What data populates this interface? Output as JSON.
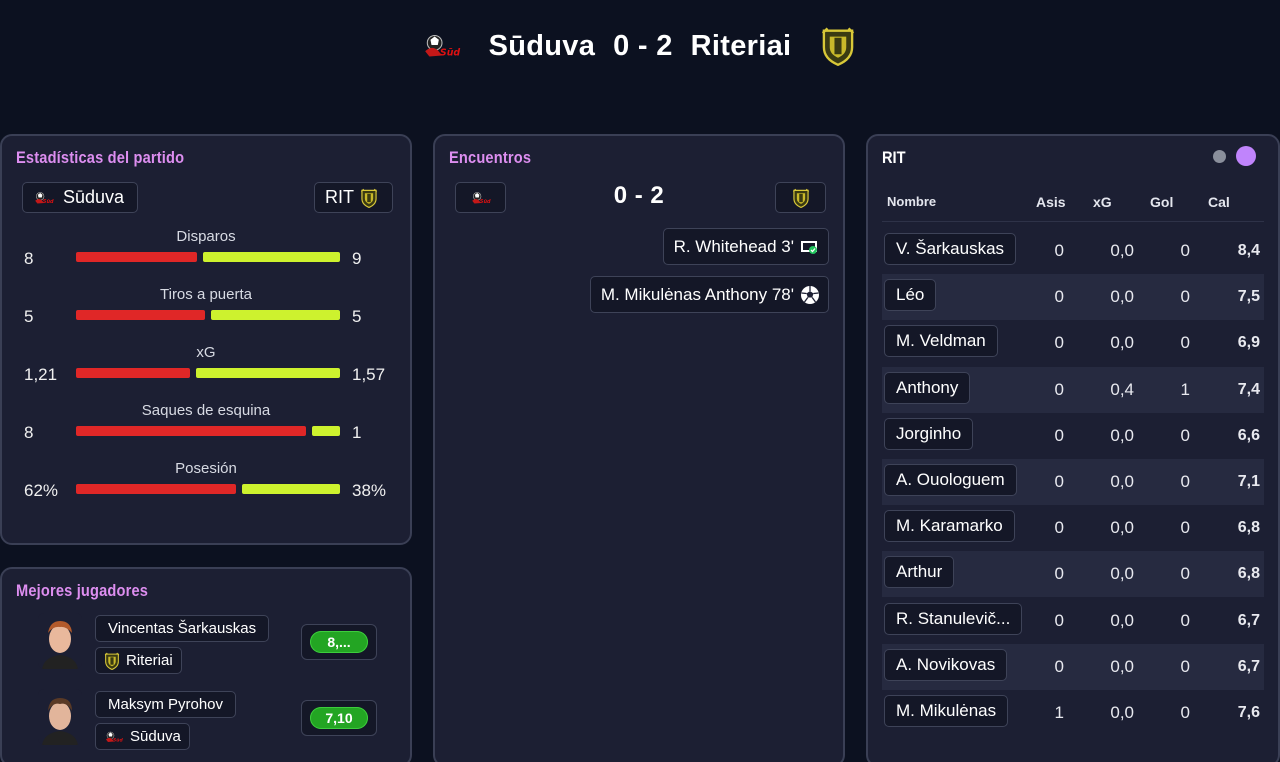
{
  "header": {
    "home_team": "Sūduva",
    "score": "0 - 2",
    "away_team": "Riteriai",
    "home_crest_icon": "suduva-crest-icon",
    "away_crest_icon": "riteriai-crest-icon"
  },
  "stats_panel": {
    "title": "Estadísticas del partido",
    "home_label": "Sūduva",
    "away_label": "RIT",
    "stats": [
      {
        "label": "Disparos",
        "home": "8",
        "away": "9",
        "home_share": 0.47
      },
      {
        "label": "Tiros a puerta",
        "home": "5",
        "away": "5",
        "home_share": 0.5
      },
      {
        "label": "xG",
        "home": "1,21",
        "away": "1,57",
        "home_share": 0.44
      },
      {
        "label": "Saques de esquina",
        "home": "8",
        "away": "1",
        "home_share": 0.89
      },
      {
        "label": "Posesión",
        "home": "62%",
        "away": "38%",
        "home_share": 0.62
      }
    ],
    "colors": {
      "home_bar": "#e02727",
      "away_bar": "#cdf22e"
    }
  },
  "best_players": {
    "title": "Mejores jugadores",
    "players": [
      {
        "name": "Vincentas Šarkauskas",
        "team": "Riteriai",
        "rating": "8,..."
      },
      {
        "name": "Maksym Pyrohov",
        "team": "Sūduva",
        "rating": "7,10"
      }
    ]
  },
  "encounters": {
    "title": "Encuentros",
    "score": "0 - 2",
    "events": [
      {
        "text": "R. Whitehead 3'",
        "icon": "save-icon"
      },
      {
        "text": "M. Mikulėnas Anthony 78'",
        "icon": "ball-icon"
      }
    ]
  },
  "player_table": {
    "team": "RIT",
    "dots": {
      "inactive": "#8a8f9c",
      "active": "#c084fc"
    },
    "columns": {
      "name": "Nombre",
      "asis": "Asis",
      "xg": "xG",
      "gol": "Gol",
      "cal": "Cal"
    },
    "rows": [
      {
        "name": "V. Šarkauskas",
        "asis": "0",
        "xg": "0,0",
        "gol": "0",
        "cal": "8,4"
      },
      {
        "name": "Léo",
        "asis": "0",
        "xg": "0,0",
        "gol": "0",
        "cal": "7,5"
      },
      {
        "name": "M. Veldman",
        "asis": "0",
        "xg": "0,0",
        "gol": "0",
        "cal": "6,9"
      },
      {
        "name": "Anthony",
        "asis": "0",
        "xg": "0,4",
        "gol": "1",
        "cal": "7,4"
      },
      {
        "name": "Jorginho",
        "asis": "0",
        "xg": "0,0",
        "gol": "0",
        "cal": "6,6"
      },
      {
        "name": "A. Ouologuem",
        "asis": "0",
        "xg": "0,0",
        "gol": "0",
        "cal": "7,1"
      },
      {
        "name": "M. Karamarko",
        "asis": "0",
        "xg": "0,0",
        "gol": "0",
        "cal": "6,8"
      },
      {
        "name": "Arthur",
        "asis": "0",
        "xg": "0,0",
        "gol": "0",
        "cal": "6,8"
      },
      {
        "name": "R. Stanulevič...",
        "asis": "0",
        "xg": "0,0",
        "gol": "0",
        "cal": "6,7"
      },
      {
        "name": "A. Novikovas",
        "asis": "0",
        "xg": "0,0",
        "gol": "0",
        "cal": "6,7"
      },
      {
        "name": "M. Mikulėnas",
        "asis": "1",
        "xg": "0,0",
        "gol": "0",
        "cal": "7,6"
      }
    ]
  }
}
